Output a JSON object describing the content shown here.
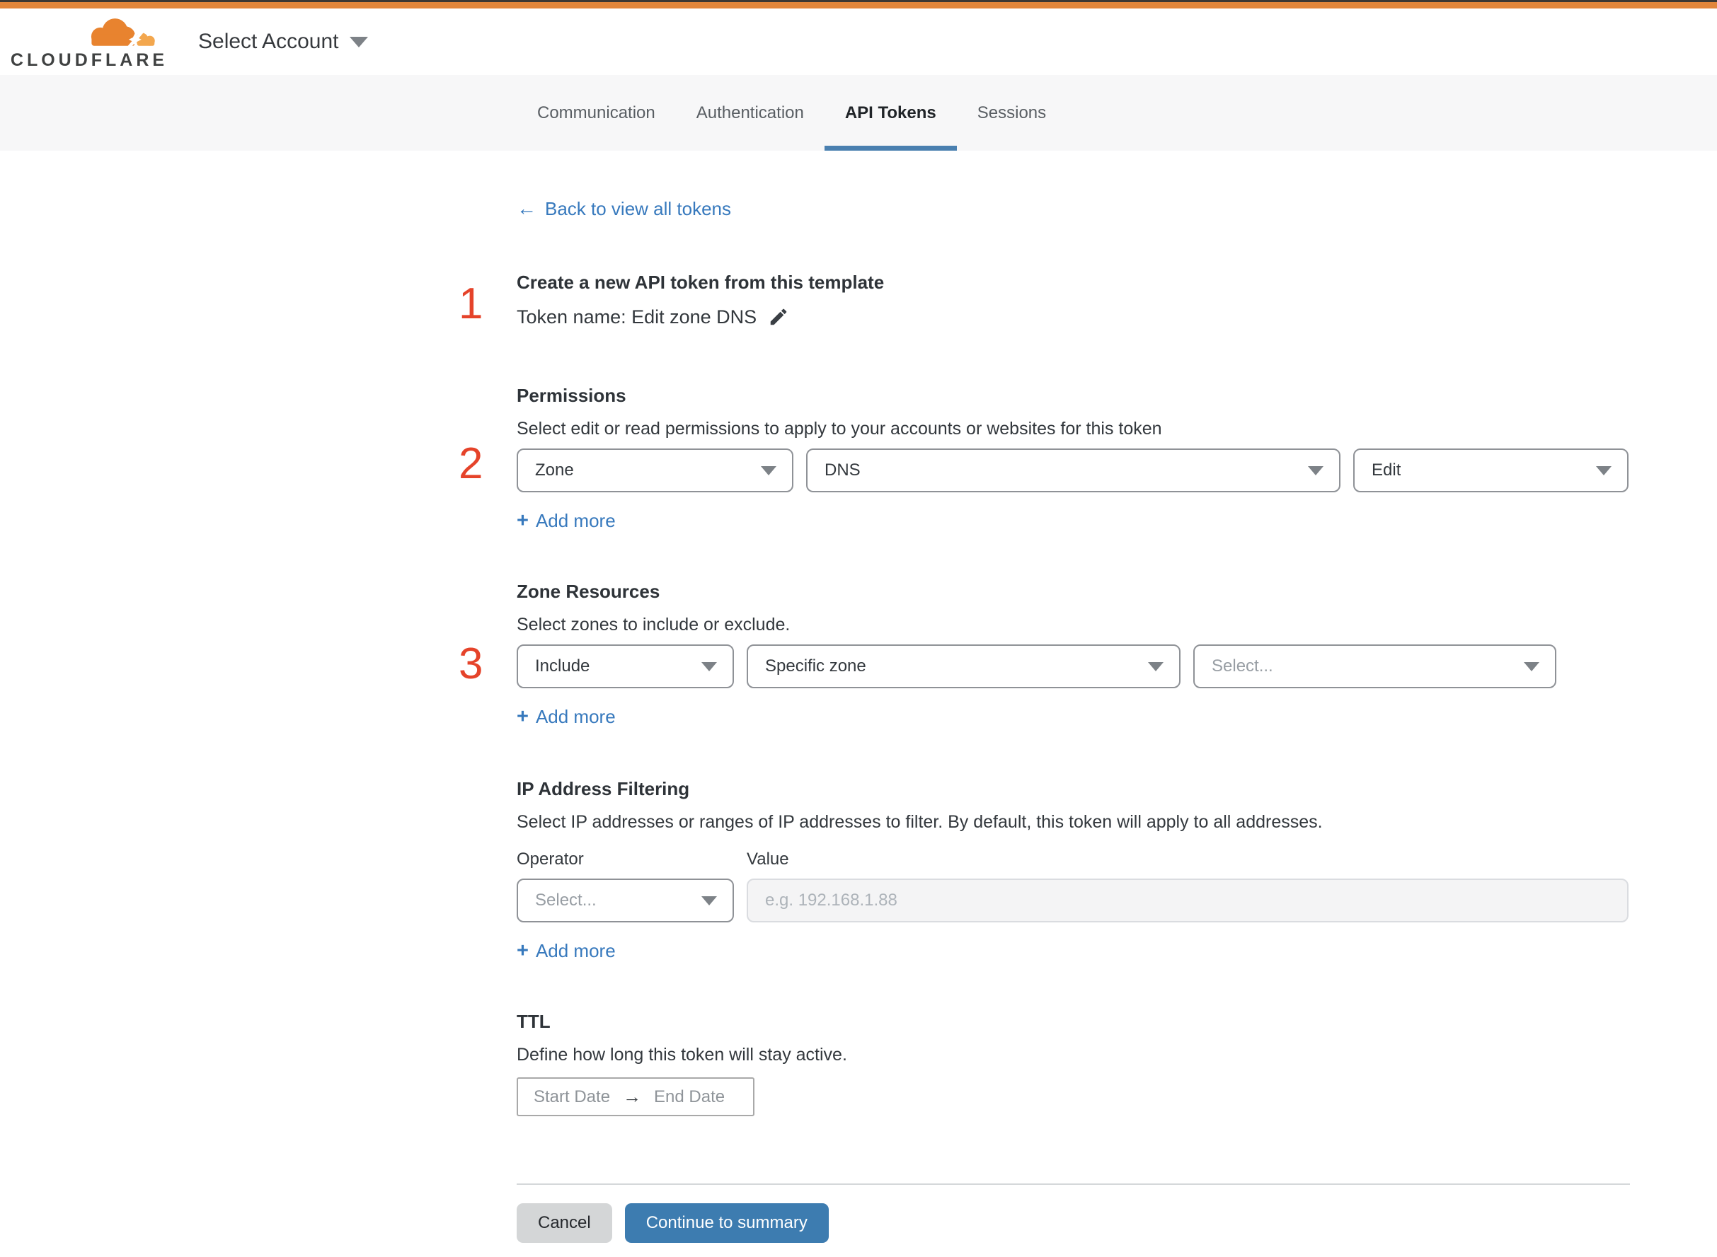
{
  "header": {
    "logo": "CLOUDFLARE",
    "account_selector": "Select Account"
  },
  "tabs": {
    "items": [
      "Communication",
      "Authentication",
      "API Tokens",
      "Sessions"
    ],
    "active": "API Tokens"
  },
  "back_link": {
    "arrow": "←",
    "label": "Back to view all tokens"
  },
  "add_more": {
    "plus": "+",
    "label": "Add more"
  },
  "create": {
    "step": "1",
    "title": "Create a new API token from this template",
    "token_name": "Token name: Edit zone DNS"
  },
  "permissions": {
    "step": "2",
    "title": "Permissions",
    "description": "Select edit or read permissions to apply to your accounts or websites for this token",
    "scope": "Zone",
    "resource": "DNS",
    "access": "Edit"
  },
  "zone_resources": {
    "step": "3",
    "title": "Zone Resources",
    "description": "Select zones to include or exclude.",
    "operator": "Include",
    "zone_type": "Specific zone",
    "zone_placeholder": "Select..."
  },
  "ip_filtering": {
    "title": "IP Address Filtering",
    "description": "Select IP addresses or ranges of IP addresses to filter. By default, this token will apply to all addresses.",
    "operator_label": "Operator",
    "value_label": "Value",
    "operator_placeholder": "Select...",
    "value_placeholder": "e.g. 192.168.1.88"
  },
  "ttl": {
    "title": "TTL",
    "description": "Define how long this token will stay active.",
    "start_label": "Start Date",
    "arrow": "→",
    "end_label": "End Date"
  },
  "footer": {
    "cancel": "Cancel",
    "continue": "Continue to summary"
  },
  "colors": {
    "brand_orange": "#e2863a",
    "top_stripe": "#3c3833",
    "accent_blue": "#3d7cb0",
    "link_blue": "#3779bd",
    "tab_underline_blue": "#4a80b0",
    "step_red": "#e5432a",
    "cloud_orange_dark": "#e8832f",
    "cloud_orange_light": "#f3a74e"
  }
}
